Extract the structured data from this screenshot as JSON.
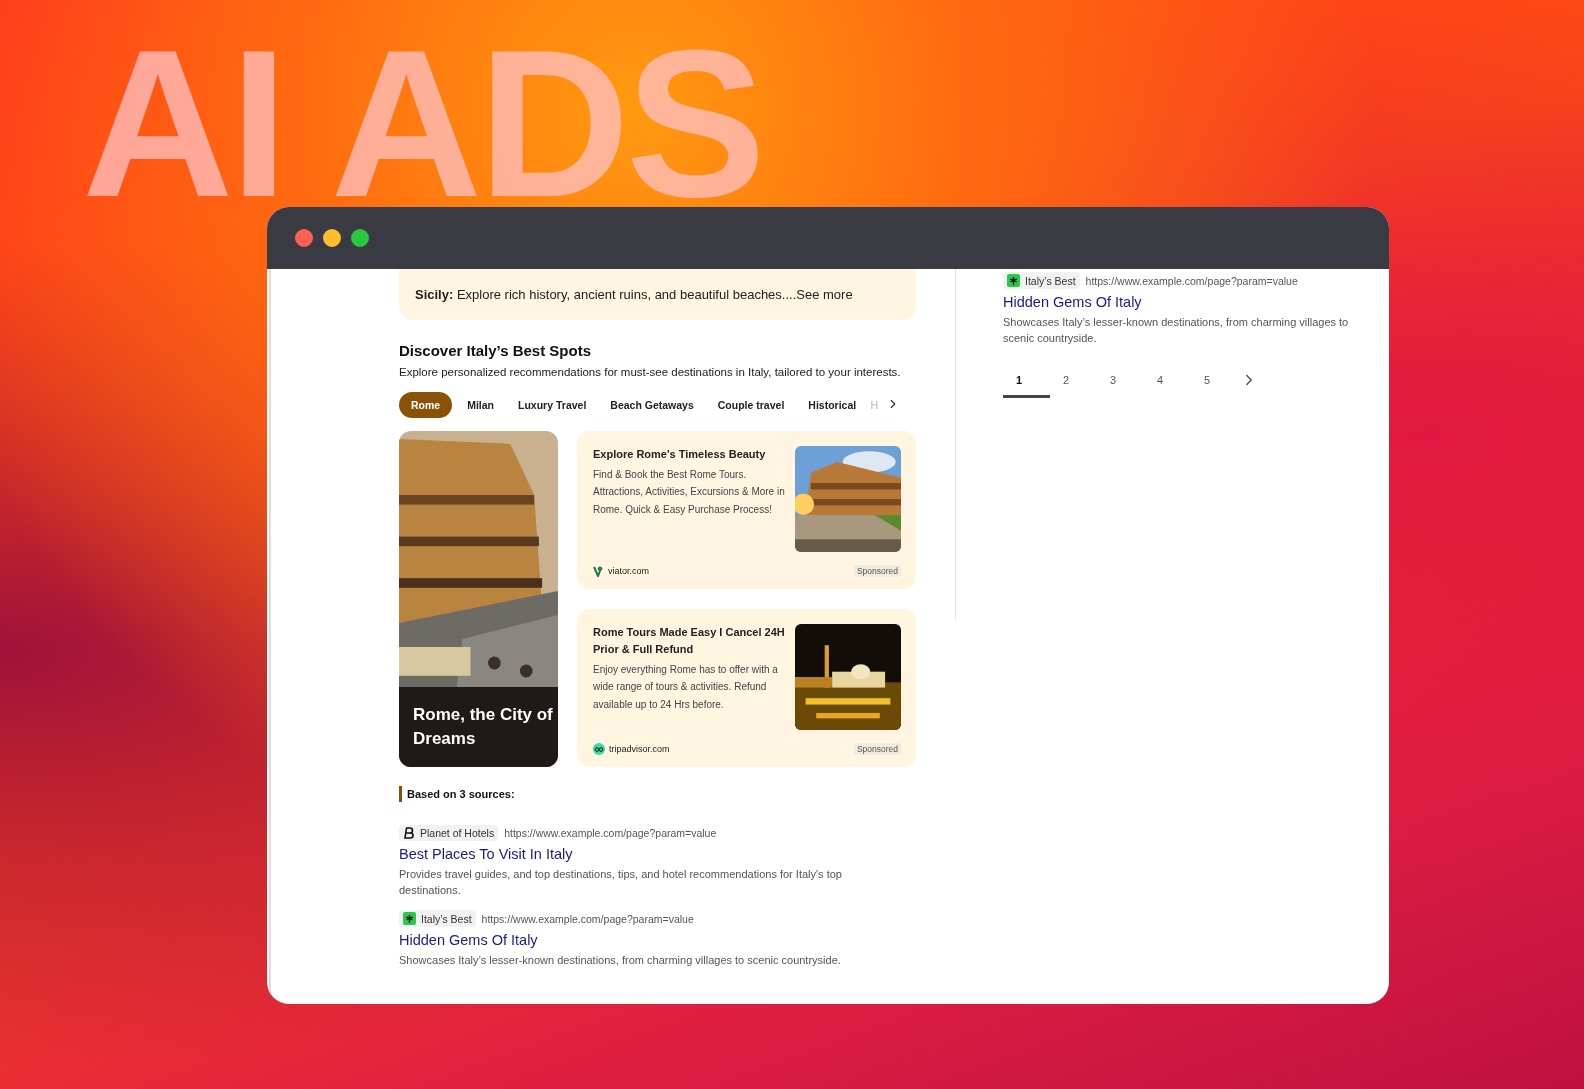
{
  "backdrop": {
    "headline": "AI ADS"
  },
  "window": {
    "controls": [
      {
        "color": "#ff5f57"
      },
      {
        "color": "#febc2e"
      },
      {
        "color": "#28c840"
      }
    ]
  },
  "intro_panel": {
    "text": "**Sicily:** Explore rich history, ancient ruins, and beautiful beaches....See more"
  },
  "discover": {
    "title": "Discover Italy’s Best Spots",
    "subtitle": "Explore personalized recommendations for must-see destinations in Italy, tailored to your interests.",
    "categories": [
      {
        "label": "Rome",
        "selected": true
      },
      {
        "label": "Milan",
        "selected": false
      },
      {
        "label": "Luxury Travel",
        "selected": false
      },
      {
        "label": "Beach Getaways",
        "selected": false
      },
      {
        "label": "Couple travel",
        "selected": false
      },
      {
        "label": "Historical",
        "selected": false
      },
      {
        "label": "H",
        "selected": false
      }
    ],
    "feature": {
      "caption": "Rome, the City of Dreams"
    },
    "ads": [
      {
        "title": "Explore Rome's Timeless Beauty",
        "description": "Find & Book the Best Rome Tours. Attractions, Activities, Excursions & More in Rome. Quick & Easy Purchase Process!",
        "site": "viator.com",
        "badge": "Sponsored"
      },
      {
        "title": "Rome Tours Made Easy I Cancel 24H Prior & Full Refund",
        "description": "Enjoy everything Rome has to offer with a wide range of tours & activities. Refund available up to 24 Hrs before.",
        "site": "tripadvisor.com",
        "badge": "Sponsored"
      }
    ]
  },
  "sources": {
    "heading": "Based on 3 sources:",
    "items": [
      {
        "site": "Planet of Hotels",
        "url": "https://www.example.com/page?param=value",
        "title": "Best Places To Visit  In Italy",
        "description": "Provides travel guides, and top destinations, tips, and hotel recommendations for Italy's top destinations."
      },
      {
        "site": "Italy’s Best",
        "url": "https://www.example.com/page?param=value",
        "title": "Hidden Gems Of Italy",
        "description": "Showcases Italy’s lesser-known destinations, from charming villages to scenic countryside."
      }
    ]
  },
  "side": {
    "result": {
      "site": "Italy’s Best",
      "url": "https://www.example.com/page?param=value",
      "title": "Hidden Gems Of Italy",
      "description": "Showcases Italy’s lesser-known destinations, from charming villages to scenic countryside."
    },
    "pages": [
      {
        "label": "1",
        "selected": true
      },
      {
        "label": "2",
        "selected": false
      },
      {
        "label": "3",
        "selected": false
      },
      {
        "label": "4",
        "selected": false
      },
      {
        "label": "5",
        "selected": false
      }
    ]
  }
}
